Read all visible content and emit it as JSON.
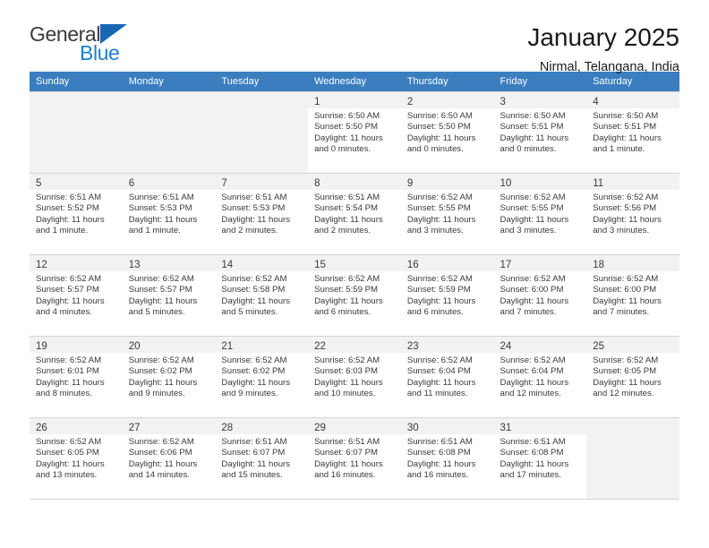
{
  "brand": {
    "name_part1": "General",
    "name_part2": "Blue",
    "triangle_icon": "triangle-logo-icon"
  },
  "header": {
    "title": "January 2025",
    "subtitle": "Nirmal, Telangana, India"
  },
  "calendar": {
    "weekday_headers": [
      "Sunday",
      "Monday",
      "Tuesday",
      "Wednesday",
      "Thursday",
      "Friday",
      "Saturday"
    ],
    "accent_color": "#3a7ec0",
    "cell_tint_color": "#f2f2f2",
    "weeks": [
      [
        {
          "day": "",
          "info": ""
        },
        {
          "day": "",
          "info": ""
        },
        {
          "day": "",
          "info": ""
        },
        {
          "day": "1",
          "info": "Sunrise: 6:50 AM\nSunset: 5:50 PM\nDaylight: 11 hours\nand 0 minutes."
        },
        {
          "day": "2",
          "info": "Sunrise: 6:50 AM\nSunset: 5:50 PM\nDaylight: 11 hours\nand 0 minutes."
        },
        {
          "day": "3",
          "info": "Sunrise: 6:50 AM\nSunset: 5:51 PM\nDaylight: 11 hours\nand 0 minutes."
        },
        {
          "day": "4",
          "info": "Sunrise: 6:50 AM\nSunset: 5:51 PM\nDaylight: 11 hours\nand 1 minute."
        }
      ],
      [
        {
          "day": "5",
          "info": "Sunrise: 6:51 AM\nSunset: 5:52 PM\nDaylight: 11 hours\nand 1 minute."
        },
        {
          "day": "6",
          "info": "Sunrise: 6:51 AM\nSunset: 5:53 PM\nDaylight: 11 hours\nand 1 minute."
        },
        {
          "day": "7",
          "info": "Sunrise: 6:51 AM\nSunset: 5:53 PM\nDaylight: 11 hours\nand 2 minutes."
        },
        {
          "day": "8",
          "info": "Sunrise: 6:51 AM\nSunset: 5:54 PM\nDaylight: 11 hours\nand 2 minutes."
        },
        {
          "day": "9",
          "info": "Sunrise: 6:52 AM\nSunset: 5:55 PM\nDaylight: 11 hours\nand 3 minutes."
        },
        {
          "day": "10",
          "info": "Sunrise: 6:52 AM\nSunset: 5:55 PM\nDaylight: 11 hours\nand 3 minutes."
        },
        {
          "day": "11",
          "info": "Sunrise: 6:52 AM\nSunset: 5:56 PM\nDaylight: 11 hours\nand 3 minutes."
        }
      ],
      [
        {
          "day": "12",
          "info": "Sunrise: 6:52 AM\nSunset: 5:57 PM\nDaylight: 11 hours\nand 4 minutes."
        },
        {
          "day": "13",
          "info": "Sunrise: 6:52 AM\nSunset: 5:57 PM\nDaylight: 11 hours\nand 5 minutes."
        },
        {
          "day": "14",
          "info": "Sunrise: 6:52 AM\nSunset: 5:58 PM\nDaylight: 11 hours\nand 5 minutes."
        },
        {
          "day": "15",
          "info": "Sunrise: 6:52 AM\nSunset: 5:59 PM\nDaylight: 11 hours\nand 6 minutes."
        },
        {
          "day": "16",
          "info": "Sunrise: 6:52 AM\nSunset: 5:59 PM\nDaylight: 11 hours\nand 6 minutes."
        },
        {
          "day": "17",
          "info": "Sunrise: 6:52 AM\nSunset: 6:00 PM\nDaylight: 11 hours\nand 7 minutes."
        },
        {
          "day": "18",
          "info": "Sunrise: 6:52 AM\nSunset: 6:00 PM\nDaylight: 11 hours\nand 7 minutes."
        }
      ],
      [
        {
          "day": "19",
          "info": "Sunrise: 6:52 AM\nSunset: 6:01 PM\nDaylight: 11 hours\nand 8 minutes."
        },
        {
          "day": "20",
          "info": "Sunrise: 6:52 AM\nSunset: 6:02 PM\nDaylight: 11 hours\nand 9 minutes."
        },
        {
          "day": "21",
          "info": "Sunrise: 6:52 AM\nSunset: 6:02 PM\nDaylight: 11 hours\nand 9 minutes."
        },
        {
          "day": "22",
          "info": "Sunrise: 6:52 AM\nSunset: 6:03 PM\nDaylight: 11 hours\nand 10 minutes."
        },
        {
          "day": "23",
          "info": "Sunrise: 6:52 AM\nSunset: 6:04 PM\nDaylight: 11 hours\nand 11 minutes."
        },
        {
          "day": "24",
          "info": "Sunrise: 6:52 AM\nSunset: 6:04 PM\nDaylight: 11 hours\nand 12 minutes."
        },
        {
          "day": "25",
          "info": "Sunrise: 6:52 AM\nSunset: 6:05 PM\nDaylight: 11 hours\nand 12 minutes."
        }
      ],
      [
        {
          "day": "26",
          "info": "Sunrise: 6:52 AM\nSunset: 6:05 PM\nDaylight: 11 hours\nand 13 minutes."
        },
        {
          "day": "27",
          "info": "Sunrise: 6:52 AM\nSunset: 6:06 PM\nDaylight: 11 hours\nand 14 minutes."
        },
        {
          "day": "28",
          "info": "Sunrise: 6:51 AM\nSunset: 6:07 PM\nDaylight: 11 hours\nand 15 minutes."
        },
        {
          "day": "29",
          "info": "Sunrise: 6:51 AM\nSunset: 6:07 PM\nDaylight: 11 hours\nand 16 minutes."
        },
        {
          "day": "30",
          "info": "Sunrise: 6:51 AM\nSunset: 6:08 PM\nDaylight: 11 hours\nand 16 minutes."
        },
        {
          "day": "31",
          "info": "Sunrise: 6:51 AM\nSunset: 6:08 PM\nDaylight: 11 hours\nand 17 minutes."
        },
        {
          "day": "",
          "info": ""
        }
      ]
    ]
  }
}
